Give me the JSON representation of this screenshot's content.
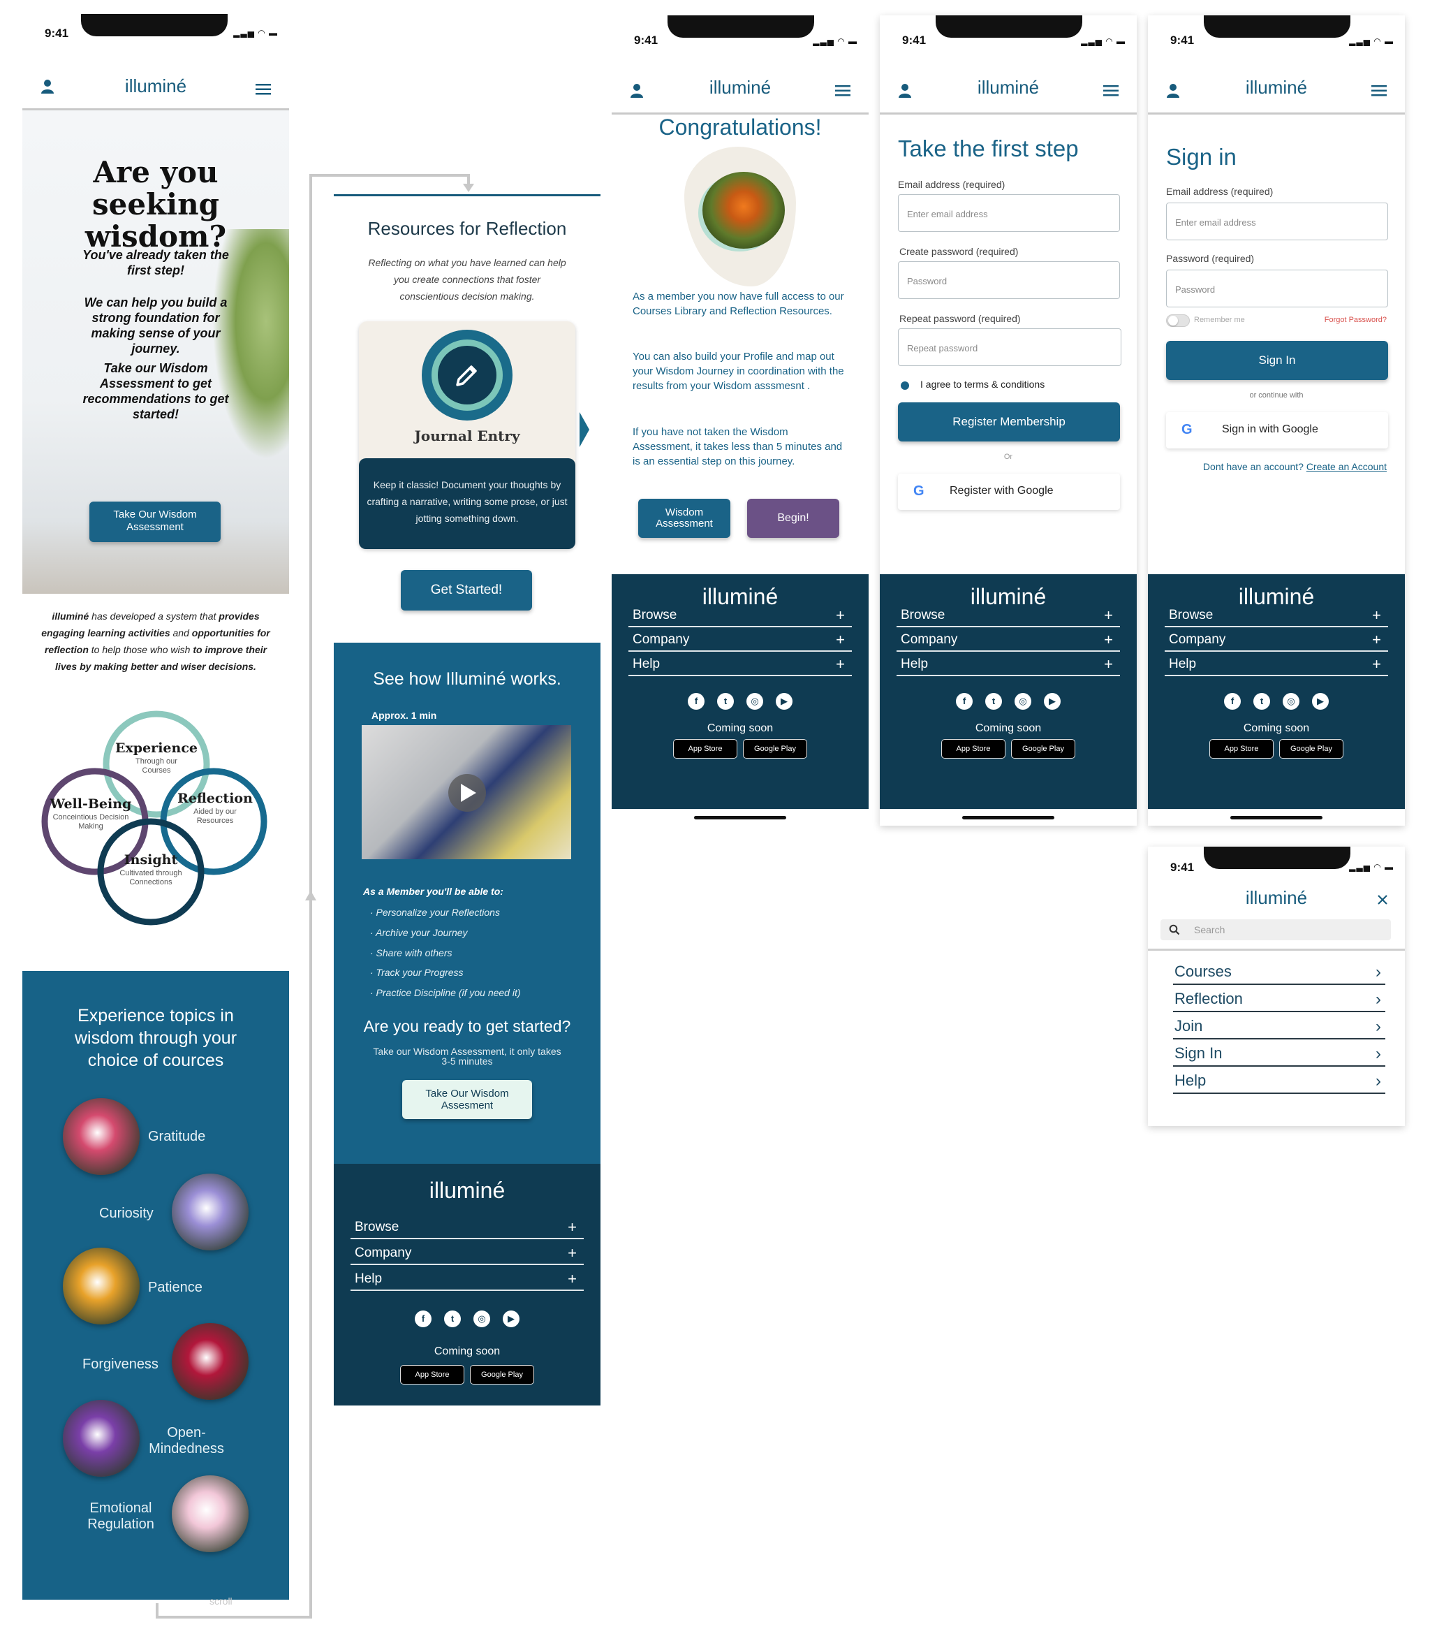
{
  "status": {
    "time": "9:41"
  },
  "brand": {
    "name": "illuminé"
  },
  "home": {
    "hero_title": "Are you seeking wisdom?",
    "hero_p1": "You've already taken the first step!",
    "hero_p2": "We can help you build a strong foundation for making sense of your journey.",
    "hero_p3": "Take our Wisdom Assessment to get recommendations to get started!",
    "hero_button": "Take Our Wisdom Assessment",
    "intro_brand": "illuminé",
    "intro_1": " has developed a system that ",
    "intro_2": "provides engaging learning activities",
    "intro_3": " and ",
    "intro_4": "opportunities for reflection",
    "intro_5": " to help those who wish ",
    "intro_6": "to improve their lives by making better and wiser decisions.",
    "diagram": {
      "experience": {
        "title": "Experience",
        "sub": "Through our Courses"
      },
      "wellbeing": {
        "title": "Well-Being",
        "sub": "Conceintious Decision Making"
      },
      "reflection": {
        "title": "Reflection",
        "sub": "Aided by our Resources"
      },
      "insight": {
        "title": "Insight",
        "sub": "Cultivated through Connections"
      }
    },
    "topics_title": "Experience topics in wisdom through your choice of cources",
    "topics": [
      {
        "label": "Gratitude",
        "color": "#d44a6e"
      },
      {
        "label": "Curiosity",
        "color": "#9b8fd6"
      },
      {
        "label": "Patience",
        "color": "#e8a22a"
      },
      {
        "label": "Forgiveness",
        "color": "#b2173b"
      },
      {
        "label": "Open-Mindedness",
        "color": "#7a3fa8"
      },
      {
        "label": "Emotional Regulation",
        "color": "#f2c7d8"
      }
    ],
    "scroll_label": "scroll"
  },
  "resources": {
    "title": "Resources for Reflection",
    "desc": "Reflecting on what you have learned can help you create connections that foster conscientious decision making.",
    "card_title": "Journal Entry",
    "card_text": "Keep it classic! Document your thoughts by crafting a narrative, writing some prose, or just jotting something down.",
    "button": "Get Started!",
    "how_title": "See how Illuminé works.",
    "video_len": "Approx. 1 min",
    "member_title": "As a Member you'll be able to:",
    "member_items": [
      "· Personalize your Reflections",
      "· Archive your Journey",
      "· Share with others",
      "· Track your Progress",
      "· Practice Discipline (if you need it)"
    ],
    "ready_title": "Are you ready to get started?",
    "ready_text": "Take our Wisdom Assessment, it only takes 3-5 minutes",
    "ready_button": "Take Our Wisdom Assesment"
  },
  "congrats": {
    "title": "Congratulations!",
    "p1": "As a member you now have full access to our Courses Library and Reflection Resources.",
    "p2": "You can also build your Profile and map out your Wisdom Journey in coordination with the results from your Wisdom asssmesnt .",
    "p3": "If you have not taken the Wisdom Assessment, it takes less than 5 minutes and is an essential step on this journey.",
    "btn_assess": "Wisdom Assessment",
    "btn_begin": "Begin!"
  },
  "register": {
    "title": "Take the first step",
    "email_label": "Email address (required)",
    "email_ph": "Enter email address",
    "pw_label": "Create password (required)",
    "pw_ph": "Password",
    "repeat_label": "Repeat password (required)",
    "repeat_ph": "Repeat password",
    "terms": "I agree to terms & conditions",
    "button": "Register Membership",
    "or": "Or",
    "google": "Register with Google"
  },
  "signin": {
    "title": "Sign in",
    "email_label": "Email address (required)",
    "email_ph": "Enter email address",
    "pw_label": "Password (required)",
    "pw_ph": "Password",
    "remember": "Remember me",
    "forgot": "Forgot Password?",
    "button": "Sign In",
    "continue": "or continue with",
    "google": "Sign in with Google",
    "no_account": "Dont have an account? ",
    "create": "Create an Account"
  },
  "menu": {
    "search_ph": "Search",
    "items": [
      "Courses",
      "Reflection",
      "Join",
      "Sign In",
      "Help"
    ]
  },
  "footer": {
    "browse": "Browse",
    "company": "Company",
    "help": "Help",
    "plus": "+",
    "coming_soon": "Coming soon",
    "app_store": "App Store",
    "google_play": "Google Play",
    "socials": [
      "facebook-icon",
      "twitter-icon",
      "instagram-icon",
      "youtube-icon"
    ]
  },
  "colors": {
    "teal": "#175b7c",
    "navy": "#0f3b52",
    "purple": "#6b5186",
    "accent": "#1a6387"
  }
}
